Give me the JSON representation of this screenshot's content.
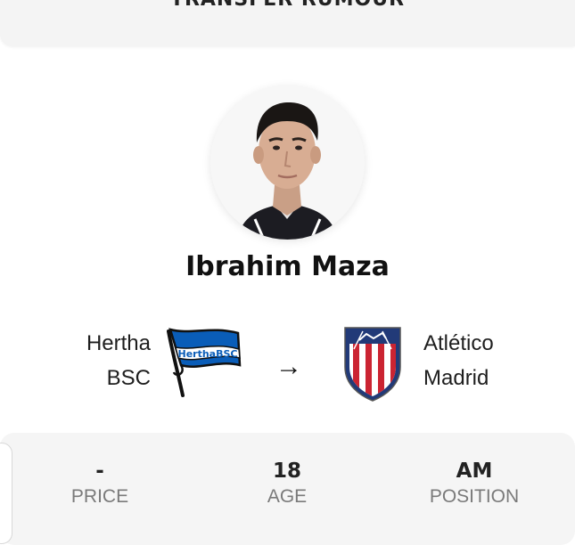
{
  "header": {
    "title": "TRANSFER RUMOUR"
  },
  "player": {
    "name": "Ibrahim Maza"
  },
  "transfer": {
    "from_club": {
      "line1": "Hertha",
      "line2": "BSC",
      "logo_text": "HerthaBSC",
      "logo_icon": "hertha-bsc-flag-logo"
    },
    "to_club": {
      "line1": "Atlético",
      "line2": "Madrid",
      "logo_icon": "atletico-madrid-crest-logo"
    },
    "arrow": "→"
  },
  "stats": {
    "price": {
      "value": "-",
      "label": "PRICE"
    },
    "age": {
      "value": "18",
      "label": "AGE"
    },
    "position": {
      "value": "AM",
      "label": "POSITION"
    }
  },
  "colors": {
    "hertha_blue": "#0a5db8",
    "atletico_red": "#cb2432",
    "atletico_navy": "#223a78",
    "panel_bg": "#f5f5f5",
    "label_gray": "#7a7a7a"
  }
}
